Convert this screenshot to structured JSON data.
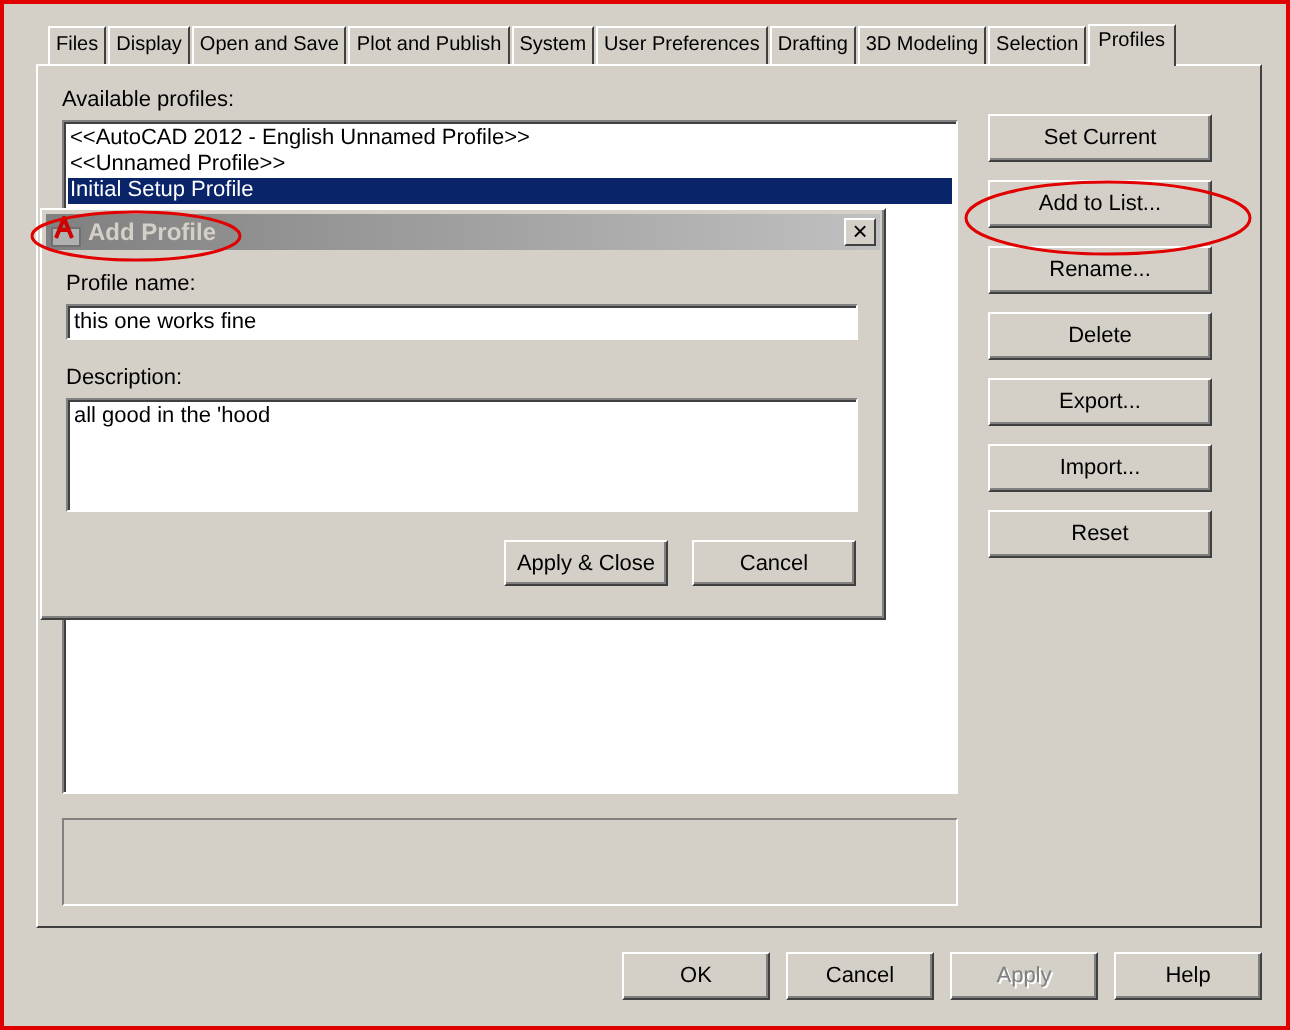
{
  "tabs": [
    {
      "label": "Files",
      "selected": false
    },
    {
      "label": "Display",
      "selected": false
    },
    {
      "label": "Open and Save",
      "selected": false
    },
    {
      "label": "Plot and Publish",
      "selected": false
    },
    {
      "label": "System",
      "selected": false
    },
    {
      "label": "User Preferences",
      "selected": false
    },
    {
      "label": "Drafting",
      "selected": false
    },
    {
      "label": "3D Modeling",
      "selected": false
    },
    {
      "label": "Selection",
      "selected": false
    },
    {
      "label": "Profiles",
      "selected": true
    }
  ],
  "available_profiles": {
    "label": "Available profiles:",
    "items": [
      {
        "text": "<<AutoCAD 2012 - English Unnamed Profile>>",
        "selected": false
      },
      {
        "text": "<<Unnamed Profile>>",
        "selected": false
      },
      {
        "text": "Initial Setup Profile",
        "selected": true
      }
    ]
  },
  "profile_buttons": [
    "Set Current",
    "Add to List...",
    "Rename...",
    "Delete",
    "Export...",
    "Import...",
    "Reset"
  ],
  "bottom_buttons": [
    {
      "label": "OK",
      "disabled": false
    },
    {
      "label": "Cancel",
      "disabled": false
    },
    {
      "label": "Apply",
      "disabled": true
    },
    {
      "label": "Help",
      "disabled": false
    }
  ],
  "dialog": {
    "title": "Add Profile",
    "close": "×",
    "name_label": "Profile name:",
    "name_value": "this one works fine",
    "description_label": "Description:",
    "description_value": "all good in the 'hood",
    "buttons": [
      "Apply & Close",
      "Cancel"
    ]
  }
}
